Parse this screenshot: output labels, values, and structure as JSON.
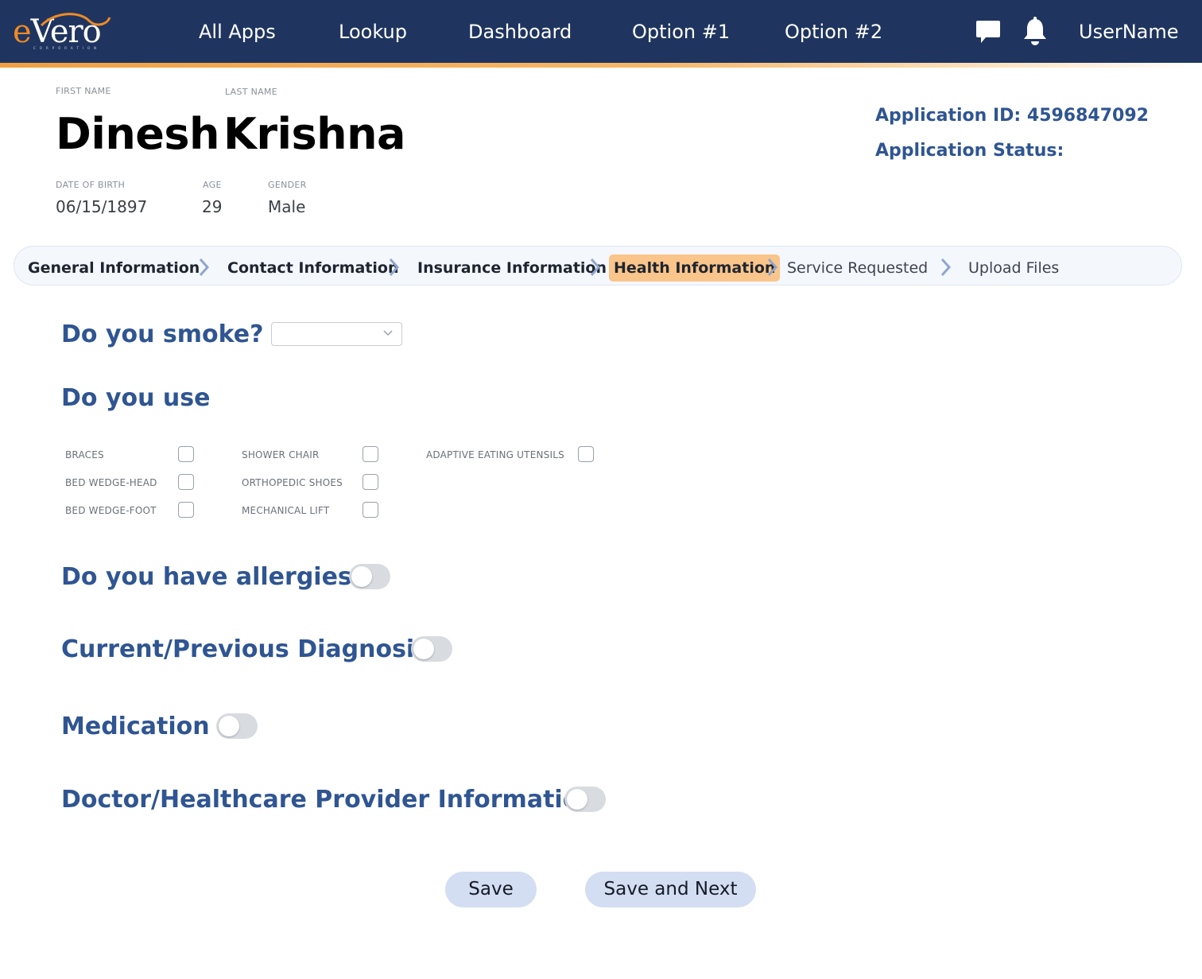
{
  "nav": {
    "logo_prefix": "e",
    "logo_text": "Vero",
    "logo_sub": "CORPORATION",
    "items": [
      "All Apps",
      "Lookup",
      "Dashboard",
      "Option #1",
      "Option #2"
    ],
    "chat_icon": "chat-bubble-icon",
    "bell_icon": "bell-icon",
    "username": "UserName"
  },
  "patient": {
    "first_name_caption": "FIRST NAME",
    "last_name_caption": "LAST NAME",
    "first_name": "Dinesh",
    "last_name": "Krishna",
    "dob_caption": "DATE OF BIRTH",
    "age_caption": "AGE",
    "gender_caption": "GENDER",
    "dob": "06/15/1897",
    "age": "29",
    "gender": "Male"
  },
  "application": {
    "id_line": "Application ID: 4596847092",
    "status_line": "Application Status:"
  },
  "steps": [
    {
      "label": "General Information",
      "state": "done"
    },
    {
      "label": "Contact Information",
      "state": "done"
    },
    {
      "label": "Insurance Information",
      "state": "done"
    },
    {
      "label": "Health Information",
      "state": "active"
    },
    {
      "label": "Service Requested",
      "state": "pending"
    },
    {
      "label": "Upload Files",
      "state": "pending"
    }
  ],
  "form": {
    "smoke_question": "Do you smoke?",
    "smoke_value": "",
    "use_question": "Do you use",
    "devices": [
      {
        "label": "BRACES",
        "checked": false
      },
      {
        "label": "BED WEDGE-HEAD",
        "checked": false
      },
      {
        "label": "BED WEDGE-FOOT",
        "checked": false
      },
      {
        "label": "SHOWER CHAIR",
        "checked": false
      },
      {
        "label": "ORTHOPEDIC SHOES",
        "checked": false
      },
      {
        "label": "MECHANICAL LIFT",
        "checked": false
      },
      {
        "label": "ADAPTIVE EATING UTENSILS",
        "checked": false
      }
    ],
    "toggles": [
      {
        "label": "Do you have allergies?",
        "on": false
      },
      {
        "label": "Current/Previous Diagnosis",
        "on": false
      },
      {
        "label": "Medication",
        "on": false
      },
      {
        "label": "Doctor/Healthcare Provider Information",
        "on": false
      }
    ]
  },
  "actions": {
    "save": "Save",
    "save_next": "Save and Next"
  },
  "colors": {
    "navbar": "#1f3560",
    "accent": "#f08a24",
    "question": "#2f5592",
    "active_step": "#fac58a",
    "button": "#d4def2"
  }
}
